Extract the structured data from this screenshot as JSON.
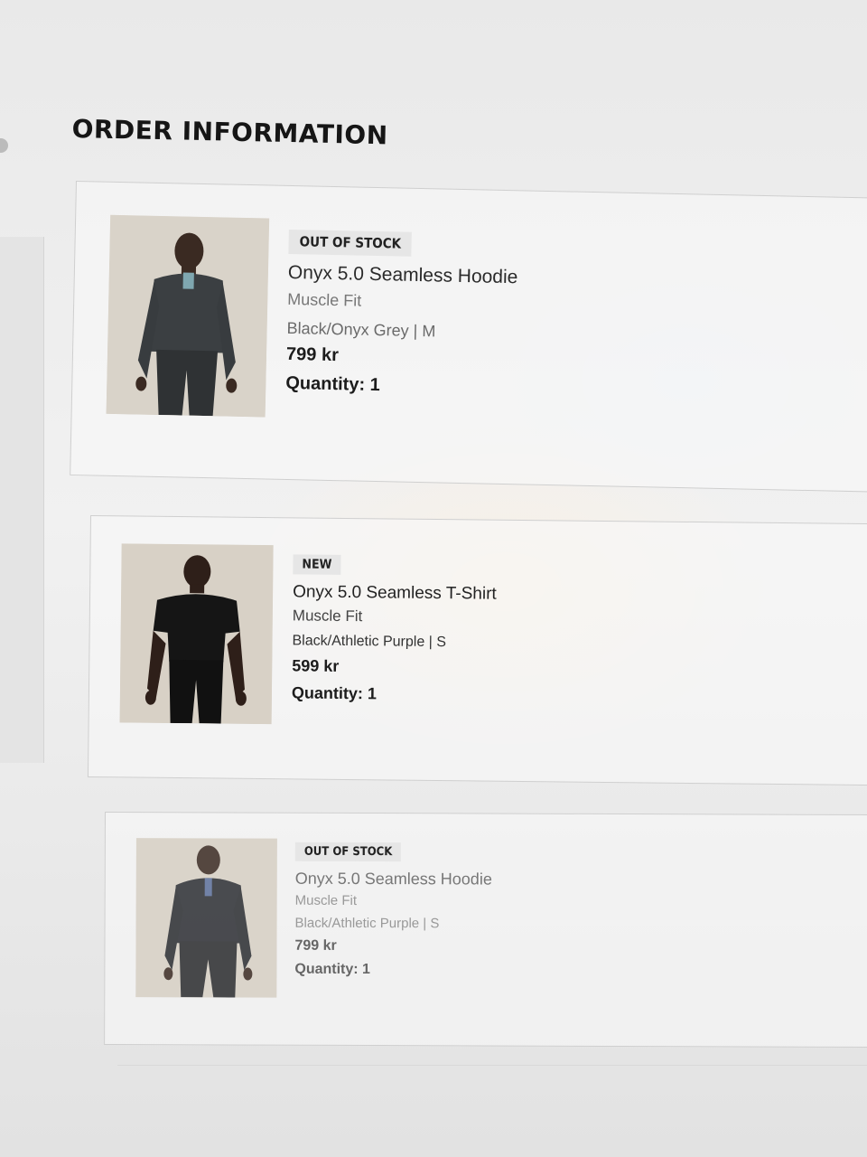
{
  "page": {
    "title": "ORDER INFORMATION"
  },
  "items": [
    {
      "badge": "OUT OF STOCK",
      "name": "Onyx 5.0 Seamless Hoodie",
      "fit": "Muscle Fit",
      "variant": "Black/Onyx Grey | M",
      "price": "799 kr",
      "quantity": "Quantity: 1",
      "image": "product-photo-hoodie-grey"
    },
    {
      "badge": "NEW",
      "name": "Onyx 5.0 Seamless T-Shirt",
      "fit": "Muscle Fit",
      "variant": "Black/Athletic Purple | S",
      "price": "599 kr",
      "quantity": "Quantity: 1",
      "image": "product-photo-tshirt-black"
    },
    {
      "badge": "OUT OF STOCK",
      "name": "Onyx 5.0 Seamless Hoodie",
      "fit": "Muscle Fit",
      "variant": "Black/Athletic Purple | S",
      "price": "799 kr",
      "quantity": "Quantity: 1",
      "image": "product-photo-hoodie-black"
    }
  ],
  "colors": {
    "background": "#ececec",
    "card_border": "#cfcfcf",
    "badge_bg": "#e6e6e6",
    "text_dark": "#1c1c1c",
    "text_muted": "#777777"
  }
}
